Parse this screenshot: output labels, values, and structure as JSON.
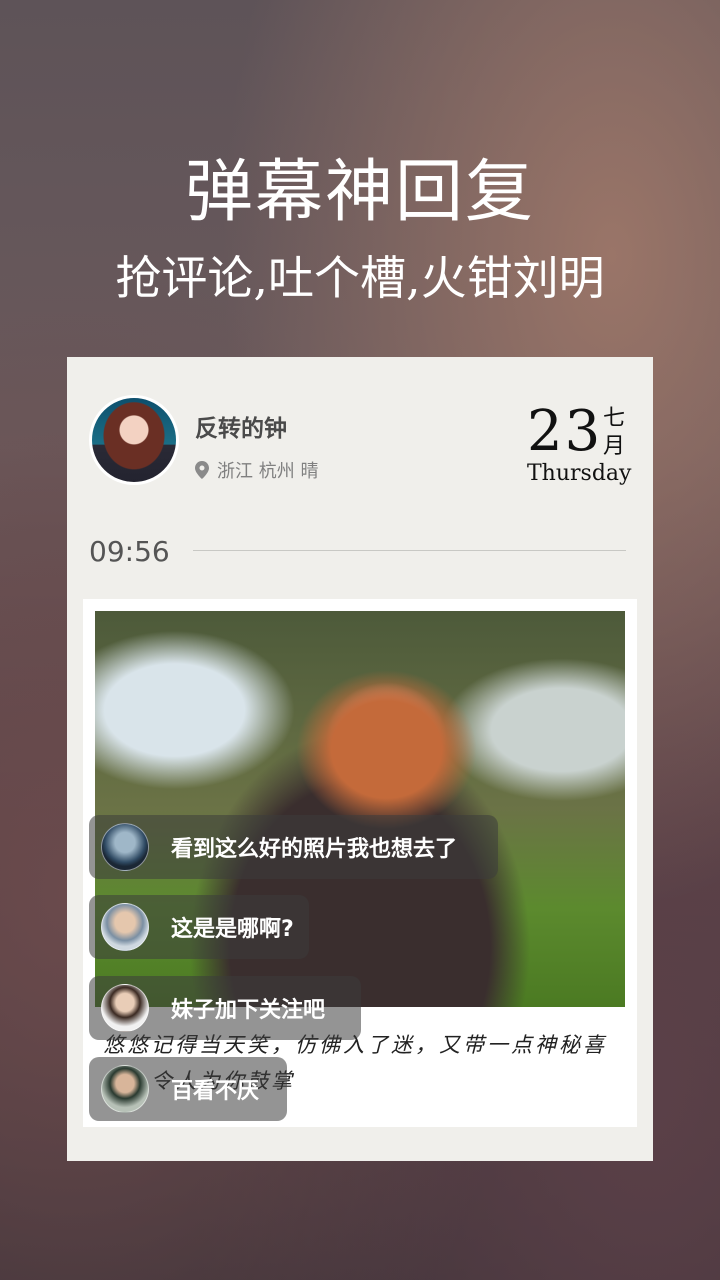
{
  "promo": {
    "title": "弹幕神回复",
    "subtitle": "抢评论,吐个槽,火钳刘明"
  },
  "card": {
    "user": {
      "name": "反转的钟",
      "location": "浙江 杭州 晴"
    },
    "date": {
      "day": "23",
      "month": "七月",
      "weekday": "Thursday"
    },
    "time": "09:56",
    "caption": "悠悠记得当天笑，仿佛入了迷，又带一点神秘喜悦，令人为你鼓掌"
  },
  "comments": [
    {
      "text": "看到这么好的照片我也想去了"
    },
    {
      "text": "这是是哪啊?"
    },
    {
      "text": "妹子加下关注吧"
    },
    {
      "text": "百看不厌"
    }
  ]
}
